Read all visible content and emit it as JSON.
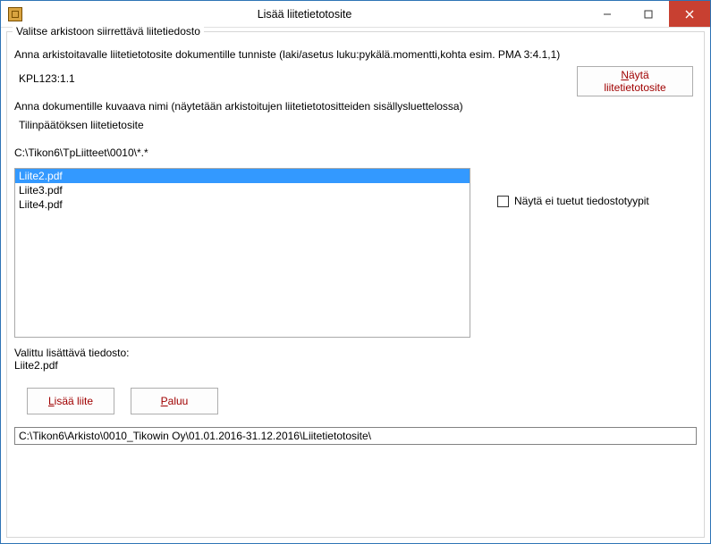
{
  "window": {
    "title": "Lisää liitetietotosite"
  },
  "group": {
    "legend": "Valitse arkistoon siirrettävä liitetiedosto",
    "instr1": "Anna arkistoitavalle liitetietotosite dokumentille tunniste (laki/asetus luku:pykälä.momentti,kohta esim. PMA 3:4.1,1)",
    "id_value": "KPL123:1.1",
    "show_button_prefix": "N",
    "show_button_rest": "äytä liitetietotosite",
    "instr2": "Anna dokumentille kuvaava nimi (näytetään arkistoitujen liitetietotositteiden sisällysluettelossa)",
    "name_value": "Tilinpäätöksen liitetietosite",
    "source_path": "C:\\Tikon6\\TpLiitteet\\0010\\*.*",
    "files": [
      "Liite2.pdf",
      "Liite3.pdf",
      "Liite4.pdf"
    ],
    "selected_index": 0,
    "show_unsupported_label": "Näytä ei tuetut tiedostotyypit",
    "show_unsupported_checked": false,
    "selected_file_heading": "Valittu lisättävä tiedosto:",
    "selected_file": "Liite2.pdf",
    "add_button_prefix": "L",
    "add_button_rest": "isää liite",
    "return_button_prefix": "P",
    "return_button_rest": "aluu",
    "archive_path": "C:\\Tikon6\\Arkisto\\0010_Tikowin Oy\\01.01.2016-31.12.2016\\Liitetietotosite\\"
  }
}
